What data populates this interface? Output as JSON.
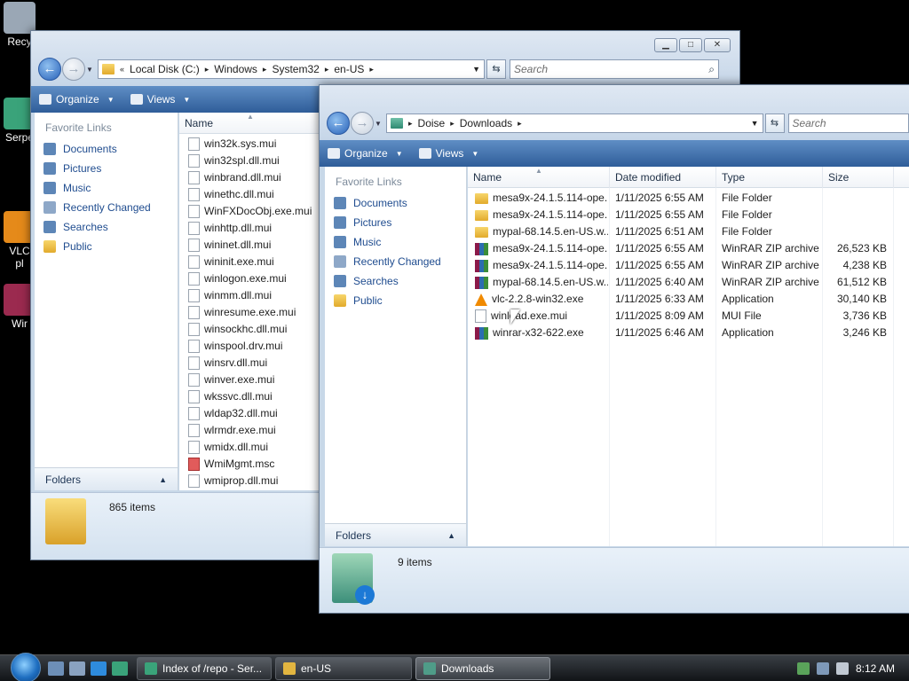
{
  "desktop": {
    "icons": [
      {
        "label": "Recy",
        "color": "#9aa7b5"
      },
      {
        "label": "Serpe",
        "color": "#3aa37a"
      },
      {
        "label": "VLC",
        "label2": "pl",
        "color": "#e58a1a"
      },
      {
        "label": "Wir",
        "color": "#9b2a4f"
      }
    ]
  },
  "back_window": {
    "breadcrumb": [
      "Local Disk (C:)",
      "Windows",
      "System32",
      "en-US"
    ],
    "search_placeholder": "Search",
    "toolbar": {
      "organize": "Organize",
      "views": "Views"
    },
    "favorite_links_title": "Favorite Links",
    "favorites": [
      "Documents",
      "Pictures",
      "Music",
      "Recently Changed",
      "Searches",
      "Public"
    ],
    "folders_label": "Folders",
    "column_name": "Name",
    "files": [
      {
        "name": "win32k.sys.mui",
        "icon": "file"
      },
      {
        "name": "win32spl.dll.mui",
        "icon": "file"
      },
      {
        "name": "winbrand.dll.mui",
        "icon": "file"
      },
      {
        "name": "winethc.dll.mui",
        "icon": "file"
      },
      {
        "name": "WinFXDocObj.exe.mui",
        "icon": "file"
      },
      {
        "name": "winhttp.dll.mui",
        "icon": "file"
      },
      {
        "name": "wininet.dll.mui",
        "icon": "file"
      },
      {
        "name": "wininit.exe.mui",
        "icon": "file"
      },
      {
        "name": "winlogon.exe.mui",
        "icon": "file"
      },
      {
        "name": "winmm.dll.mui",
        "icon": "file"
      },
      {
        "name": "winresume.exe.mui",
        "icon": "file"
      },
      {
        "name": "winsockhc.dll.mui",
        "icon": "file"
      },
      {
        "name": "winspool.drv.mui",
        "icon": "file"
      },
      {
        "name": "winsrv.dll.mui",
        "icon": "file"
      },
      {
        "name": "winver.exe.mui",
        "icon": "file"
      },
      {
        "name": "wkssvc.dll.mui",
        "icon": "file"
      },
      {
        "name": "wldap32.dll.mui",
        "icon": "file"
      },
      {
        "name": "wlrmdr.exe.mui",
        "icon": "file"
      },
      {
        "name": "wmidx.dll.mui",
        "icon": "file"
      },
      {
        "name": "WmiMgmt.msc",
        "icon": "msc"
      },
      {
        "name": "wmiprop.dll.mui",
        "icon": "file"
      }
    ],
    "item_count": "865 items"
  },
  "front_window": {
    "breadcrumb": [
      "Doise",
      "Downloads"
    ],
    "search_placeholder": "Search",
    "toolbar": {
      "organize": "Organize",
      "views": "Views"
    },
    "favorite_links_title": "Favorite Links",
    "favorites": [
      "Documents",
      "Pictures",
      "Music",
      "Recently Changed",
      "Searches",
      "Public"
    ],
    "folders_label": "Folders",
    "columns": {
      "name": "Name",
      "date": "Date modified",
      "type": "Type",
      "size": "Size"
    },
    "files": [
      {
        "name": "mesa9x-24.1.5.114-ope...",
        "date": "1/11/2025 6:55 AM",
        "type": "File Folder",
        "size": "",
        "icon": "folder"
      },
      {
        "name": "mesa9x-24.1.5.114-ope...",
        "date": "1/11/2025 6:55 AM",
        "type": "File Folder",
        "size": "",
        "icon": "folder"
      },
      {
        "name": "mypal-68.14.5.en-US.w...",
        "date": "1/11/2025 6:51 AM",
        "type": "File Folder",
        "size": "",
        "icon": "folder"
      },
      {
        "name": "mesa9x-24.1.5.114-ope...",
        "date": "1/11/2025 6:55 AM",
        "type": "WinRAR ZIP archive",
        "size": "26,523 KB",
        "icon": "rar"
      },
      {
        "name": "mesa9x-24.1.5.114-ope...",
        "date": "1/11/2025 6:55 AM",
        "type": "WinRAR ZIP archive",
        "size": "4,238 KB",
        "icon": "rar"
      },
      {
        "name": "mypal-68.14.5.en-US.w...",
        "date": "1/11/2025 6:40 AM",
        "type": "WinRAR ZIP archive",
        "size": "61,512 KB",
        "icon": "rar"
      },
      {
        "name": "vlc-2.2.8-win32.exe",
        "date": "1/11/2025 6:33 AM",
        "type": "Application",
        "size": "30,140 KB",
        "icon": "vlc"
      },
      {
        "name": "winload.exe.mui",
        "date": "1/11/2025 8:09 AM",
        "type": "MUI File",
        "size": "3,736 KB",
        "icon": "file"
      },
      {
        "name": "winrar-x32-622.exe",
        "date": "1/11/2025 6:46 AM",
        "type": "Application",
        "size": "3,246 KB",
        "icon": "app"
      }
    ],
    "item_count": "9 items"
  },
  "taskbar": {
    "buttons": [
      {
        "label": "Index of /repo - Ser...",
        "color": "#3aa37a"
      },
      {
        "label": "en-US",
        "color": "#e2b540"
      },
      {
        "label": "Downloads",
        "color": "#4f9c88"
      }
    ],
    "clock": "8:12 AM"
  }
}
